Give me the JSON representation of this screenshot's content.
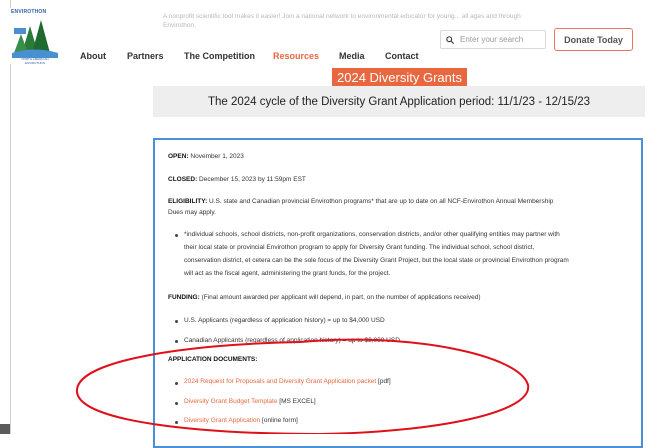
{
  "brand": {
    "logo_text": "ENVIROTHON",
    "logo_sub": "NORTH AMERICAN ENVIROTHON"
  },
  "header": {
    "faded_text": "A nonprofit scientific tool makes it easier! Join a national network to environmental educator for young... all ages and through Envirothon.",
    "search_placeholder": "Enter your search",
    "donate_label": "Donate Today"
  },
  "nav": [
    "About",
    "Partners",
    "The Competition",
    "Resources",
    "Media",
    "Contact"
  ],
  "page": {
    "title": "2024 Diversity Grants",
    "subtitle": "The 2024 cycle of the Diversity Grant Application period: 11/1/23 - 12/15/23"
  },
  "content": {
    "open_label": "OPEN:",
    "open_value": " November 1, 2023",
    "closed_label": "CLOSED:",
    "closed_value": " December 15, 2023 by 11:59pm EST",
    "elig_label": "ELIGIBILITY:",
    "elig_line1": " U.S. state and Canadian provincial Envirothon programs* that are up to date on all NCF-Envirothon Annual Membership",
    "elig_line2": "Dues may apply.",
    "note_line1": "*individual schools, school districts, non-profit organizations, conservation districts, and/or other qualifying entities may partner with",
    "note_line2": "their local state or provincial Envirothon program to apply for Diversity Grant funding. The individual school, school district,",
    "note_line3": "conservation district, et cetera can be the sole focus of the Diversity Grant Project, but the local state or provincial Envirothon program",
    "note_line4": "will act as the fiscal agent, administering the grant funds, for the project.",
    "funding_label": "FUNDING:",
    "funding_value": " (Final amount awarded per applicant will depend, in part, on the number of applications received)",
    "funding_us": "U.S. Applicants (regardless of application history) = up to $4,000 USD",
    "funding_ca": "Canadian Applicants (regardless of application history) = up to $2,000 USD",
    "docs_label": "APPLICATION DOCUMENTS:",
    "doc1_link": "2024 Request for Proposals and Diversity Grant Application packet",
    "doc1_suffix": " [pdf]",
    "doc2_link": "Diversity Grant Budget Template",
    "doc2_suffix": " [MS EXCEL]",
    "doc3_link": "Diversity Grant Application",
    "doc3_suffix": " [online form]"
  },
  "colors": {
    "accent": "#e8673f",
    "box_border": "#4a90d9",
    "annotation": "#e0101a"
  }
}
